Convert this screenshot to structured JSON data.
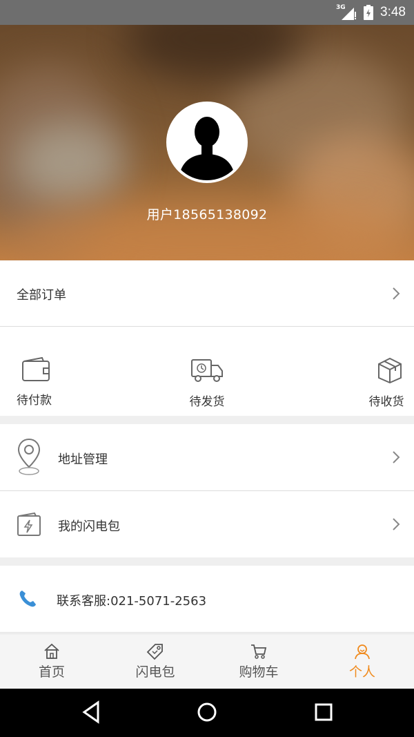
{
  "status_bar": {
    "time": "3:48",
    "network": "3G"
  },
  "profile": {
    "username": "用户18565138092"
  },
  "orders": {
    "all_orders_label": "全部订单",
    "statuses": [
      {
        "label": "待付款",
        "icon": "wallet-icon"
      },
      {
        "label": "待发货",
        "icon": "delivery-truck-icon"
      },
      {
        "label": "待收货",
        "icon": "package-box-icon"
      }
    ]
  },
  "menu": {
    "address": {
      "label": "地址管理",
      "icon": "location-pin-icon"
    },
    "wallet": {
      "label": "我的闪电包",
      "icon": "lightning-wallet-icon"
    },
    "service": {
      "label": "联系客服:021-5071-2563",
      "icon": "phone-icon"
    }
  },
  "tabs": [
    {
      "label": "首页",
      "icon": "home-icon",
      "active": false
    },
    {
      "label": "闪电包",
      "icon": "tag-icon",
      "active": false
    },
    {
      "label": "购物车",
      "icon": "cart-icon",
      "active": false
    },
    {
      "label": "个人",
      "icon": "profile-icon",
      "active": true
    }
  ],
  "colors": {
    "accent": "#f08a1c",
    "phone_icon": "#3a8fd6",
    "gap": "#efefef"
  }
}
